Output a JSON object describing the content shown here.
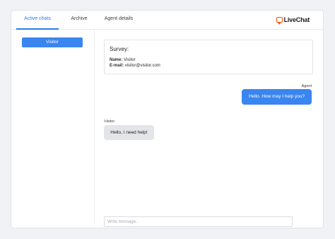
{
  "tabs": [
    {
      "label": "Active chats",
      "active": true
    },
    {
      "label": "Archive",
      "active": false
    },
    {
      "label": "Agent details",
      "active": false
    }
  ],
  "brand": {
    "name": "LiveChat",
    "accent_color": "#ff5100",
    "icon": "chat-bubble-icon"
  },
  "sidebar": {
    "visitor_button": "Visitor"
  },
  "survey": {
    "title": "Survey:",
    "name_label": "Name:",
    "name_value": "Visitor",
    "email_label": "E-mail:",
    "email_value": "visitor@visitor.com"
  },
  "messages": [
    {
      "author": "Agent",
      "text": "Hello. How may I help you?"
    },
    {
      "author": "Visitor",
      "text": "Hello, I need help!"
    }
  ],
  "composer": {
    "placeholder": "Write message..."
  },
  "colors": {
    "primary": "#3a85ef",
    "visitor_bubble": "#e3e5e9"
  }
}
